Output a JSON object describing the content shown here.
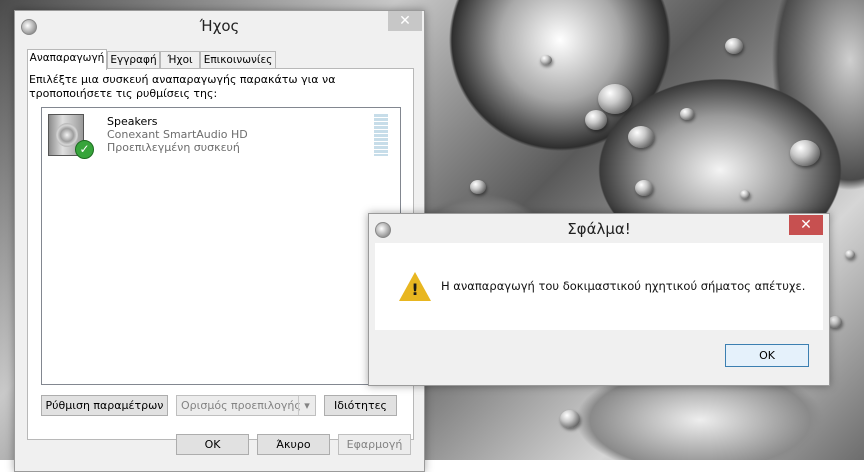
{
  "sound_window": {
    "title": "Ήχος",
    "close_glyph": "✕",
    "tabs": [
      "Αναπαραγωγή",
      "Εγγραφή",
      "Ήχοι",
      "Επικοινωνίες"
    ],
    "active_tab": "Αναπαραγωγή",
    "instruction": "Επιλέξτε μια συσκευή αναπαραγωγής παρακάτω για να τροποποιήσετε τις ρυθμίσεις της:",
    "device": {
      "name": "Speakers",
      "driver": "Conexant SmartAudio HD",
      "status": "Προεπιλεγμένη συσκευή",
      "icon": "speaker-icon",
      "default_badge_icon": "check-icon"
    },
    "buttons": {
      "configure": "Ρύθμιση παραμέτρων",
      "set_default": "Ορισμός προεπιλογής",
      "set_default_arrow": "▾",
      "properties": "Ιδιότητες",
      "ok": "ΟΚ",
      "cancel": "Άκυρο",
      "apply": "Εφαρμογή"
    }
  },
  "error_dialog": {
    "title": "Σφάλμα!",
    "close_glyph": "✕",
    "icon": "warning-icon",
    "warning_mark": "!",
    "message": "Η αναπαραγωγή του δοκιμαστικού ηχητικού σήματος απέτυχε.",
    "ok_button": "ΟΚ"
  },
  "colors": {
    "close_active": "#c75050",
    "check_green": "#37a43b",
    "warning_yellow": "#e8b620"
  }
}
